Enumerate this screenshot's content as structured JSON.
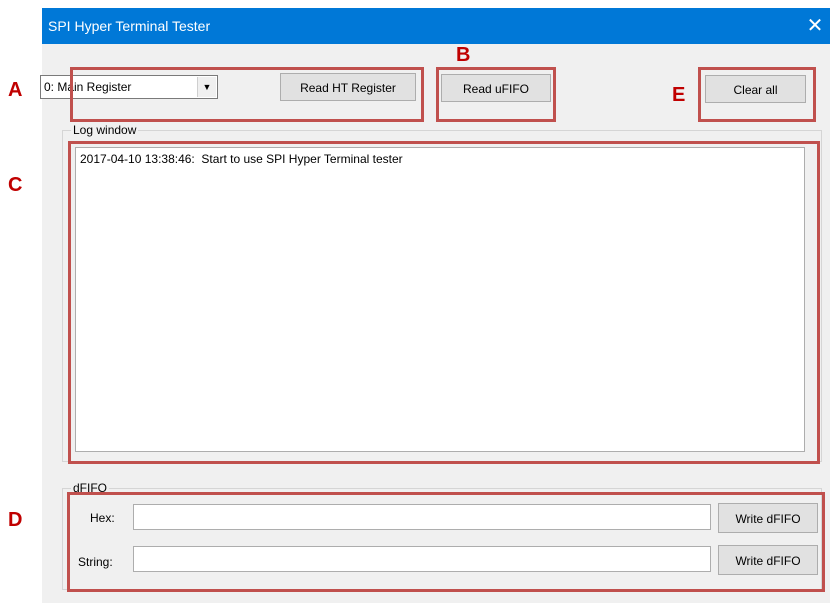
{
  "window": {
    "title": "SPI Hyper Terminal Tester",
    "close_glyph": "✕"
  },
  "toolbar": {
    "register_select": {
      "value": "0: Main Register",
      "arrow_glyph": "▼"
    },
    "read_ht_register_label": "Read HT Register",
    "read_ufifo_label": "Read uFIFO",
    "clear_all_label": "Clear all"
  },
  "log": {
    "group_label": "Log window",
    "lines": [
      "2017-04-10 13:38:46:  Start to use SPI Hyper Terminal tester"
    ]
  },
  "dfifo": {
    "group_label": "dFIFO",
    "hex_label": "Hex:",
    "hex_value": "",
    "string_label": "String:",
    "string_value": "",
    "write_hex_label": "Write dFIFO",
    "write_string_label": "Write dFIFO"
  },
  "annotations": {
    "a": "A",
    "b": "B",
    "c": "C",
    "d": "D",
    "e": "E",
    "color": "#c0504d"
  },
  "colors": {
    "titlebar": "#0078d7",
    "window_bg": "#f0f0f0"
  }
}
